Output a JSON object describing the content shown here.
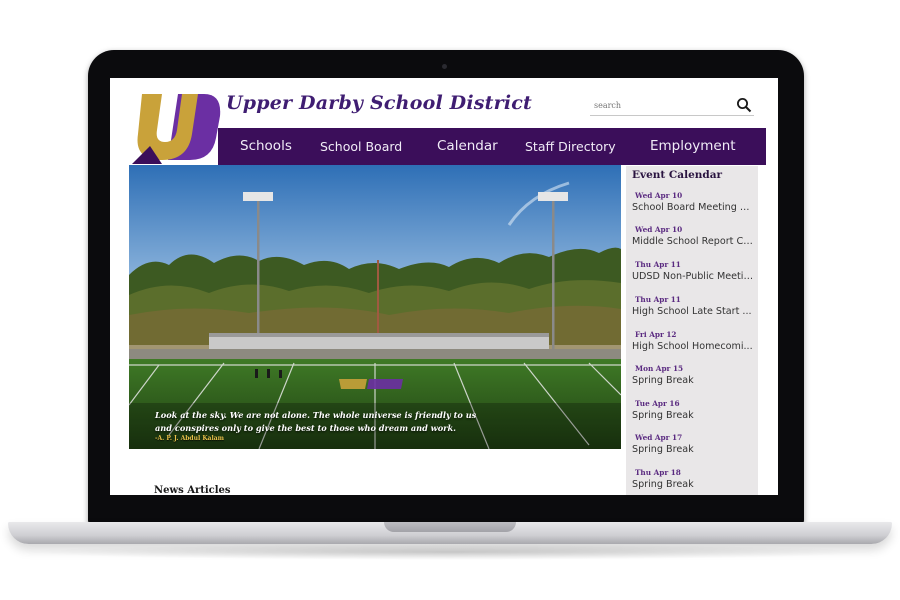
{
  "site": {
    "title": "Upper Darby School District",
    "logo_text": "UD"
  },
  "search": {
    "placeholder": "search",
    "value": ""
  },
  "nav": {
    "items": [
      {
        "label": "Schools"
      },
      {
        "label": "School Board"
      },
      {
        "label": "Calendar"
      },
      {
        "label": "Staff Directory"
      },
      {
        "label": "Employment"
      }
    ]
  },
  "hero": {
    "quote": "Look at the sky. We are not alone. The whole universe is friendly to us and conspires only to give the best to those who dream and work.",
    "author": "-A. P. J. Abdul Kalam"
  },
  "events": {
    "heading": "Event Calendar",
    "items": [
      {
        "date": "Wed Apr 10",
        "title": "School Board Meeting @..."
      },
      {
        "date": "Wed Apr 10",
        "title": "Middle School Report Ca..."
      },
      {
        "date": "Thu Apr 11",
        "title": "UDSD Non-Public Meetin..."
      },
      {
        "date": "Thu Apr 11",
        "title": "High School Late Start ..."
      },
      {
        "date": "Fri Apr 12",
        "title": "High School Homecomi..."
      },
      {
        "date": "Mon Apr 15",
        "title": "Spring Break"
      },
      {
        "date": "Tue Apr 16",
        "title": "Spring Break"
      },
      {
        "date": "Wed Apr 17",
        "title": "Spring Break"
      },
      {
        "date": "Thu Apr 18",
        "title": "Spring Break"
      }
    ]
  },
  "news": {
    "heading": "News Articles"
  },
  "colors": {
    "brand_purple": "#3b0e5a",
    "title_purple": "#3f1d72",
    "logo_gold": "#c9a23a",
    "logo_violet": "#6b2fa3"
  }
}
